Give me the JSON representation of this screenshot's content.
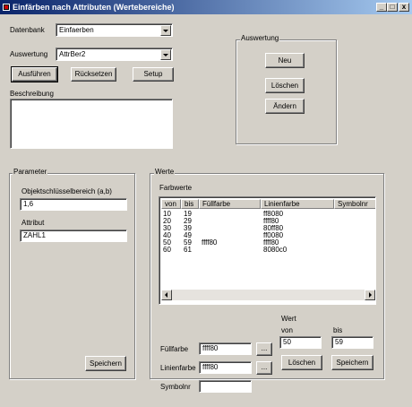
{
  "window": {
    "title": "Einfärben nach Attributen (Wertebereiche)",
    "min_label": "_",
    "max_label": "□",
    "close_label": "x"
  },
  "top": {
    "datenbank_label": "Datenbank",
    "datenbank_value": "Einfaerben",
    "auswertung_label": "Auswertung",
    "auswertung_value": "AttrBer2",
    "ausfuehren_label": "Ausführen",
    "ruecksetzen_label": "Rücksetzen",
    "setup_label": "Setup",
    "beschreibung_label": "Beschreibung",
    "beschreibung_value": ""
  },
  "auswertung_group": {
    "label": "Auswertung",
    "neu_label": "Neu",
    "loeschen_label": "Löschen",
    "aendern_label": "Ändern"
  },
  "parameter_group": {
    "label": "Parameter",
    "objekt_label": "Objektschlüsselbereich (a,b)",
    "objekt_value": "1,6",
    "attribut_label": "Attribut",
    "attribut_value": "ZAHL1",
    "speichern_label": "Speichern"
  },
  "werte_group": {
    "label": "Werte",
    "farbwerte_label": "Farbwerte",
    "columns": [
      "von",
      "bis",
      "Füllfarbe",
      "Linienfarbe",
      "Symbolnr"
    ],
    "rows": [
      [
        "10",
        "19",
        "",
        "ff8080",
        ""
      ],
      [
        "20",
        "29",
        "",
        "ffff80",
        ""
      ],
      [
        "30",
        "39",
        "",
        "80ff80",
        ""
      ],
      [
        "40",
        "49",
        "",
        "ff0080",
        ""
      ],
      [
        "50",
        "59",
        "ffff80",
        "ffff80",
        ""
      ],
      [
        "60",
        "61",
        "",
        "8080c0",
        ""
      ]
    ],
    "fuellfarbe_label": "Füllfarbe",
    "fuellfarbe_value": "ffff80",
    "linienfarbe_label": "Linienfarbe",
    "linienfarbe_value": "ffff80",
    "symbolnr_label": "Symbolnr",
    "symbolnr_value": "",
    "browse_label": "...",
    "wert_label": "Wert",
    "von_label": "von",
    "bis_label": "bis",
    "von_value": "50",
    "bis_value": "59",
    "loeschen_label": "Löschen",
    "speichern_label": "Speichern"
  },
  "colors": {
    "title_start": "#0a246a",
    "title_end": "#a6caf0",
    "face": "#d4d0c8"
  }
}
